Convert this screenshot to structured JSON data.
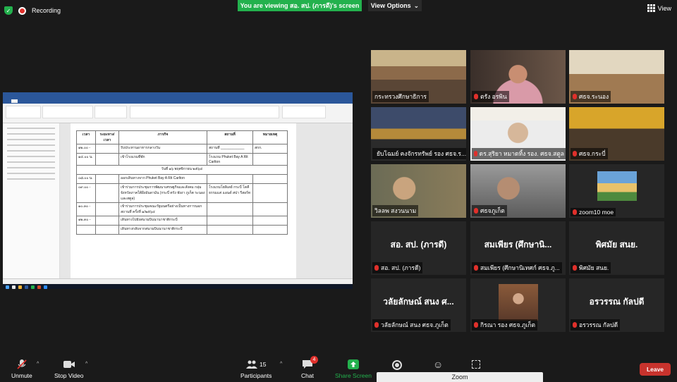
{
  "top_bar": {
    "recording_label": "Recording",
    "viewing_banner": "You are viewing สอ. สป. (ภารดี)'s screen",
    "view_options_label": "View Options",
    "view_label": "View"
  },
  "shared_document": {
    "column_headers": [
      "เวลา",
      "ระยะทาง/เวลา",
      "ภารกิจ",
      "สถานที่",
      "หมายเหตุ"
    ],
    "rows_block1": [
      {
        "time": "๑๒.๐๐ -",
        "task": "รับประทานอาหารกลางวัน",
        "place": "สถานที่ ____________",
        "note": "สกก."
      },
      {
        "time": "๑๔.๐๐ น.",
        "task": "เข้าโรงแรมที่พัก",
        "place": "โรงแรม Phuket Bay A Rit Carlton",
        "note": ""
      }
    ],
    "day_heading": "วันที่ ๑๖ พฤศจิกายน ๒๕๖๔",
    "rows_block2": [
      {
        "time": "๐๘.๐๐ น.",
        "task": "ออกเดินทางจาก Phuket Bay A Rit Carlton",
        "place": "",
        "note": ""
      },
      {
        "time": "๐๙.๐๐ -",
        "task": "เข้าร่วมการประชุมการพัฒนาเศรษฐกิจและสังคม กลุ่มจังหวัดภาคใต้ฝั่งอันดามัน (กระบี่ ตรัง พังงา ภูเก็ต ระนอง และสตูล)",
        "place": "โรงแรมโฮลิเดย์ กระบี่ โคคีธรรมแค่ แอนด์ สปา รีสอร์ท",
        "note": ""
      },
      {
        "time": "๑๐.๓๐ -",
        "task": "เข้าร่วมการประชุมคณะรัฐมนตรีอย่างเป็นทางการนอกสถานที่ ครั้งที่ ๑/๒๕๖๔",
        "place": "",
        "note": ""
      },
      {
        "time": "๑๒.๓๐ -",
        "task": "เดินทางไปยังสนามบินนานาชาติกระบี่",
        "place": "",
        "note": ""
      },
      {
        "time": "",
        "task": "เดินทางกลับจากสนามบินนานาชาติกระบี่",
        "place": "",
        "note": ""
      }
    ]
  },
  "participants": [
    {
      "name": "กระทรวงศึกษาธิการ",
      "active": true,
      "muted": false,
      "has_video": true
    },
    {
      "name": "ตรัง อรพิน",
      "active": false,
      "muted": true,
      "has_video": true
    },
    {
      "name": "ศธจ.ระนอง",
      "active": false,
      "muted": true,
      "has_video": true
    },
    {
      "name": "ยับโฉมย์ คงจักรทรัพย์ รอง ศธจ.ร...",
      "active": false,
      "muted": true,
      "has_video": true
    },
    {
      "name": "ดร.สุริยา หมาดทิ้ง รอง. ศธจ.สตูล",
      "active": false,
      "muted": true,
      "has_video": true
    },
    {
      "name": "ศธจ.กระบี่",
      "active": false,
      "muted": true,
      "has_video": true
    },
    {
      "name": "วิลลพ สงวนนาม",
      "active": false,
      "muted": false,
      "has_video": true
    },
    {
      "name": "ศธจภูเก็ต",
      "active": false,
      "muted": true,
      "has_video": true
    },
    {
      "name": "zoom10 moe",
      "active": false,
      "muted": true,
      "has_video": true
    },
    {
      "name": "สอ. สป. (ภารดี)",
      "big_name": "สอ. สป. (ภารดี)",
      "active": false,
      "muted": true,
      "has_video": false
    },
    {
      "name": "สมเพียร (ศึกษานิเทศก์ ศธจ.ภู...",
      "big_name": "สมเพียร (ศึกษานิ...",
      "active": false,
      "muted": true,
      "has_video": false
    },
    {
      "name": "พิศมัย สนย.",
      "big_name": "พิศมัย สนย.",
      "active": false,
      "muted": true,
      "has_video": false
    },
    {
      "name": "วลัยลักษณ์ สนง ศธจ.ภูเก็ต",
      "big_name": "วลัยลักษณ์ สนง ศ...",
      "active": false,
      "muted": true,
      "has_video": false
    },
    {
      "name": "กิรณา รอง ศธจ.ภูเก็ต",
      "active": false,
      "muted": true,
      "has_video": true
    },
    {
      "name": "อรวรรณ กัลปดี",
      "big_name": "อรวรรณ กัลปดี",
      "active": false,
      "muted": true,
      "has_video": false
    }
  ],
  "toolbar": {
    "unmute_label": "Unmute",
    "stop_video_label": "Stop Video",
    "participants_label": "Participants",
    "participants_count": "15",
    "chat_label": "Chat",
    "chat_badge": "4",
    "share_screen_label": "Share Screen",
    "leave_label": "Leave",
    "zoom_bar_label": "Zoom"
  },
  "colors": {
    "green": "#23b14d",
    "red": "#e0302b",
    "active_border": "#b9e04a",
    "background": "#1a1a1a"
  }
}
